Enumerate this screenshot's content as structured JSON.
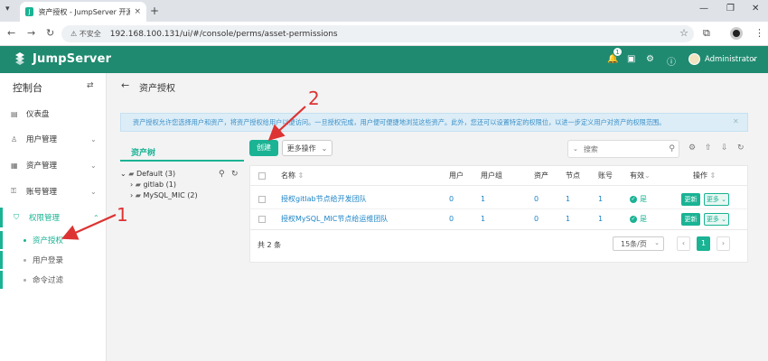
{
  "browser": {
    "tab_title": "资产授权 - JumpServer 开源堡",
    "tab_close": "×",
    "new_tab": "+",
    "insecure_label": "不安全",
    "url": "192.168.100.131/ui/#/console/perms/asset-permissions"
  },
  "header": {
    "brand": "JumpServer",
    "notification_count": "1",
    "user_name": "Administrator"
  },
  "sidebar": {
    "title": "控制台",
    "items": [
      {
        "label": "仪表盘",
        "icon": "dashboard-icon"
      },
      {
        "label": "用户管理",
        "icon": "users-icon"
      },
      {
        "label": "资产管理",
        "icon": "assets-icon"
      },
      {
        "label": "账号管理",
        "icon": "accounts-icon"
      },
      {
        "label": "权限管理",
        "icon": "shield-icon"
      }
    ],
    "sub_items": [
      {
        "label": "资产授权"
      },
      {
        "label": "用户登录"
      },
      {
        "label": "命令过滤"
      }
    ]
  },
  "page": {
    "title": "资产授权",
    "alert": "资产授权允许您选择用户和资产，将资产授权给用户以便访问。一旦授权完成，用户便可便捷地浏览这些资产。此外，您还可以设置特定的权限位，以进一步定义用户对资产的权限范围。"
  },
  "tree": {
    "tab_label": "资产树",
    "nodes": [
      {
        "label": "Default (3)"
      },
      {
        "label": "gitlab (1)"
      },
      {
        "label": "MySQL_MIC (2)"
      }
    ]
  },
  "toolbar": {
    "create_label": "创建",
    "more_label": "更多操作",
    "search_placeholder": "搜索"
  },
  "table": {
    "columns": [
      "名称",
      "用户",
      "用户组",
      "资产",
      "节点",
      "账号",
      "有效",
      "操作"
    ],
    "rows": [
      {
        "name": "授权gitlab节点给开发团队",
        "users": "0",
        "user_groups": "1",
        "assets": "0",
        "nodes": "1",
        "accounts": "1",
        "valid": "是"
      },
      {
        "name": "授权MySQL_MIC节点给运维团队",
        "users": "0",
        "user_groups": "1",
        "assets": "0",
        "nodes": "1",
        "accounts": "1",
        "valid": "是"
      }
    ],
    "update_label": "更新",
    "row_more_label": "更多",
    "total_text": "共 2 条",
    "page_size": "15条/页",
    "current_page": "1"
  },
  "annotations": {
    "label_1": "1",
    "label_2": "2"
  },
  "colors": {
    "brand": "#1f8a70",
    "accent": "#1ab394",
    "link": "#1c84c6",
    "annotation": "#dd3333"
  }
}
